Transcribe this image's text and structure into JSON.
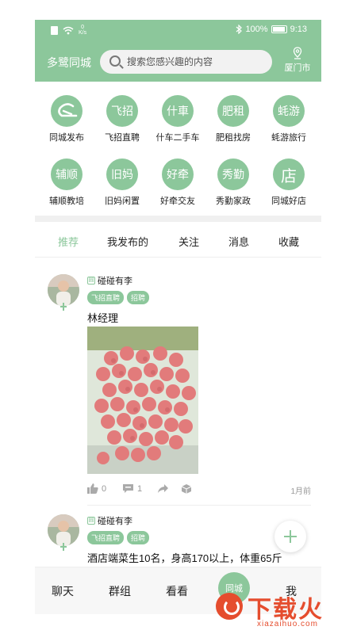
{
  "status_bar": {
    "speed_value": "0",
    "speed_unit": "K/s",
    "battery": "100%",
    "time": "9:13"
  },
  "header": {
    "app_title": "多鹭同城",
    "search_placeholder": "搜索您感兴趣的内容",
    "city": "厦门市"
  },
  "categories": [
    {
      "glyph": "",
      "label": "同城发布"
    },
    {
      "glyph": "飞招",
      "label": "飞招直聘"
    },
    {
      "glyph": "什車",
      "label": "什车二手车"
    },
    {
      "glyph": "肥租",
      "label": "肥租找房"
    },
    {
      "glyph": "蚝游",
      "label": "蚝游旅行"
    },
    {
      "glyph": "辅顺",
      "label": "辅顺教培"
    },
    {
      "glyph": "旧妈",
      "label": "旧妈闲置"
    },
    {
      "glyph": "好牵",
      "label": "好牵交友"
    },
    {
      "glyph": "秀勤",
      "label": "秀勤家政"
    },
    {
      "glyph": "店",
      "label": "同城好店"
    }
  ],
  "tabs": [
    {
      "label": "推荐",
      "active": true
    },
    {
      "label": "我发布的",
      "active": false
    },
    {
      "label": "关注",
      "active": false
    },
    {
      "label": "消息",
      "active": false
    },
    {
      "label": "收藏",
      "active": false
    }
  ],
  "posts": [
    {
      "gender_glyph": "圆",
      "username": "碰碰有李",
      "tags": [
        "飞招直聘",
        "招聘"
      ],
      "text": "林经理",
      "likes": "0",
      "comments": "1",
      "time": "1月前"
    },
    {
      "gender_glyph": "圆",
      "username": "碰碰有李",
      "tags": [
        "飞招直聘",
        "招聘"
      ],
      "text": "酒店端菜生10名，身高170以上，体重65斤"
    }
  ],
  "bottom_nav": {
    "chat": "聊天",
    "groups": "群组",
    "watch": "看看",
    "center": "同城",
    "me": "我"
  },
  "watermark": {
    "text": "下载火",
    "domain": "xiazaihuo.com"
  },
  "colors": {
    "brand_green": "#8cc79b",
    "watermark_red": "#e54d2e"
  }
}
